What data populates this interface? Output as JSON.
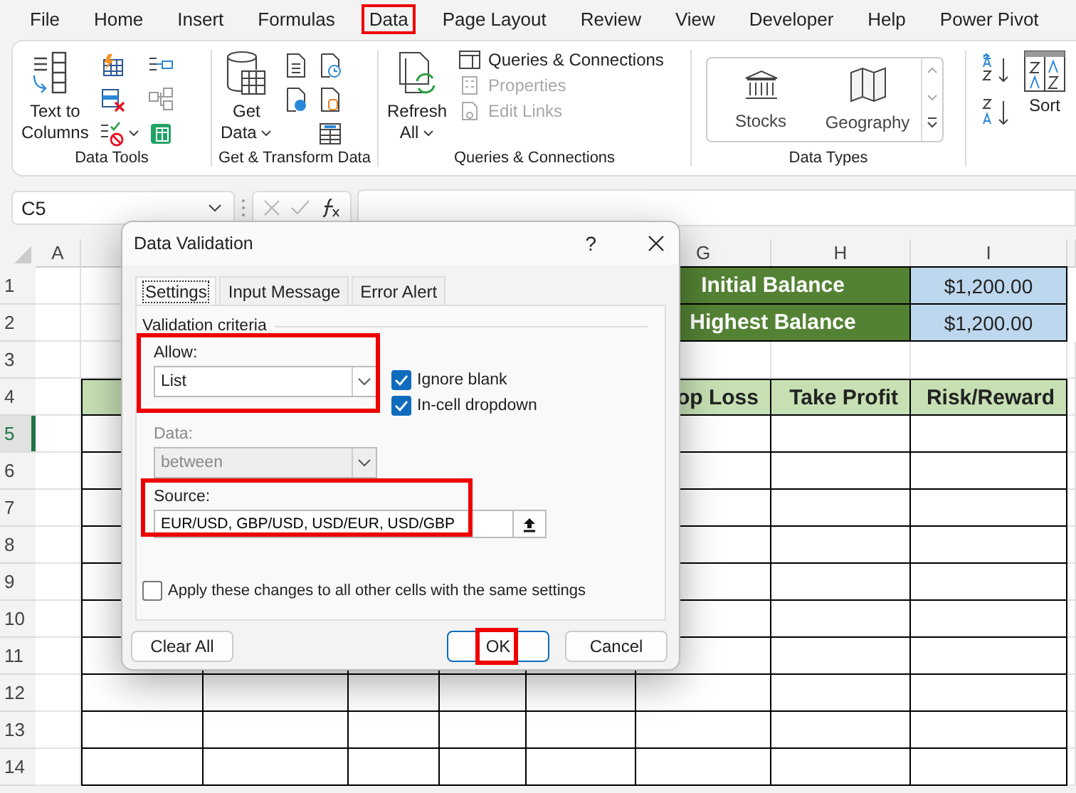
{
  "menu_tabs": [
    {
      "label": "File",
      "selected": false
    },
    {
      "label": "Home",
      "selected": false
    },
    {
      "label": "Insert",
      "selected": false
    },
    {
      "label": "Formulas",
      "selected": false
    },
    {
      "label": "Data",
      "selected": true
    },
    {
      "label": "Page Layout",
      "selected": false
    },
    {
      "label": "Review",
      "selected": false
    },
    {
      "label": "View",
      "selected": false
    },
    {
      "label": "Developer",
      "selected": false
    },
    {
      "label": "Help",
      "selected": false
    },
    {
      "label": "Power Pivot",
      "selected": false
    }
  ],
  "ribbon": {
    "groups": [
      {
        "kind": "data_tools",
        "title": "Data Tools",
        "big_button": "Text to\nColumns"
      },
      {
        "kind": "get_transform",
        "title": "Get & Transform Data",
        "big_button": "Get\nData"
      },
      {
        "kind": "queries",
        "title": "Queries & Connections",
        "big_button": "Refresh\nAll",
        "items": [
          {
            "label": "Queries & Connections",
            "disabled": false
          },
          {
            "label": "Properties",
            "disabled": true
          },
          {
            "label": "Edit Links",
            "disabled": true
          }
        ]
      },
      {
        "kind": "data_types",
        "title": "Data Types",
        "items": [
          {
            "label": "Stocks"
          },
          {
            "label": "Geography"
          }
        ]
      },
      {
        "kind": "sort",
        "big_button": "Sort"
      }
    ]
  },
  "name_box": {
    "value": "C5"
  },
  "sheet": {
    "column_headers": [
      {
        "label": "A"
      },
      {
        "label": "G"
      },
      {
        "label": "H"
      },
      {
        "label": "I"
      }
    ],
    "row_headers": [
      {
        "label": "1",
        "selected": false
      },
      {
        "label": "2",
        "selected": false
      },
      {
        "label": "3",
        "selected": false
      },
      {
        "label": "4",
        "selected": false
      },
      {
        "label": "5",
        "selected": true
      },
      {
        "label": "6",
        "selected": false
      },
      {
        "label": "7",
        "selected": false
      },
      {
        "label": "8",
        "selected": false
      },
      {
        "label": "9",
        "selected": false
      },
      {
        "label": "10",
        "selected": false
      },
      {
        "label": "11",
        "selected": false
      },
      {
        "label": "12",
        "selected": false
      },
      {
        "label": "13",
        "selected": false
      },
      {
        "label": "14",
        "selected": false
      }
    ],
    "balances": [
      {
        "label": "Initial Balance",
        "value": "$1,200.00"
      },
      {
        "label": "Highest Balance",
        "value": "$1,200.00"
      }
    ],
    "table_headers": [
      {
        "text": "op Loss"
      },
      {
        "text": "Take Profit"
      },
      {
        "text": "Risk/Reward"
      }
    ]
  },
  "dialog": {
    "title": "Data Validation",
    "help": "?",
    "tabs": [
      {
        "label": "Settings",
        "selected": true
      },
      {
        "label": "Input Message",
        "selected": false
      },
      {
        "label": "Error Alert",
        "selected": false
      }
    ],
    "section": "Validation criteria",
    "allow": {
      "label": "Allow:",
      "value": "List",
      "highlighted": true
    },
    "checkboxes": [
      {
        "label": "Ignore blank",
        "checked": true
      },
      {
        "label": "In-cell dropdown",
        "checked": true
      }
    ],
    "data": {
      "label": "Data:",
      "value": "between",
      "disabled": true
    },
    "source": {
      "label": "Source:",
      "value": "EUR/USD, GBP/USD, USD/EUR, USD/GBP",
      "highlighted": true
    },
    "apply_all": {
      "label": "Apply these changes to all other cells with the same settings",
      "checked": false
    },
    "buttons": [
      {
        "label": "Clear All",
        "default": false,
        "highlighted": false
      },
      {
        "label": "OK",
        "default": true,
        "highlighted": true
      },
      {
        "label": "Cancel",
        "default": false,
        "highlighted": false
      }
    ]
  }
}
